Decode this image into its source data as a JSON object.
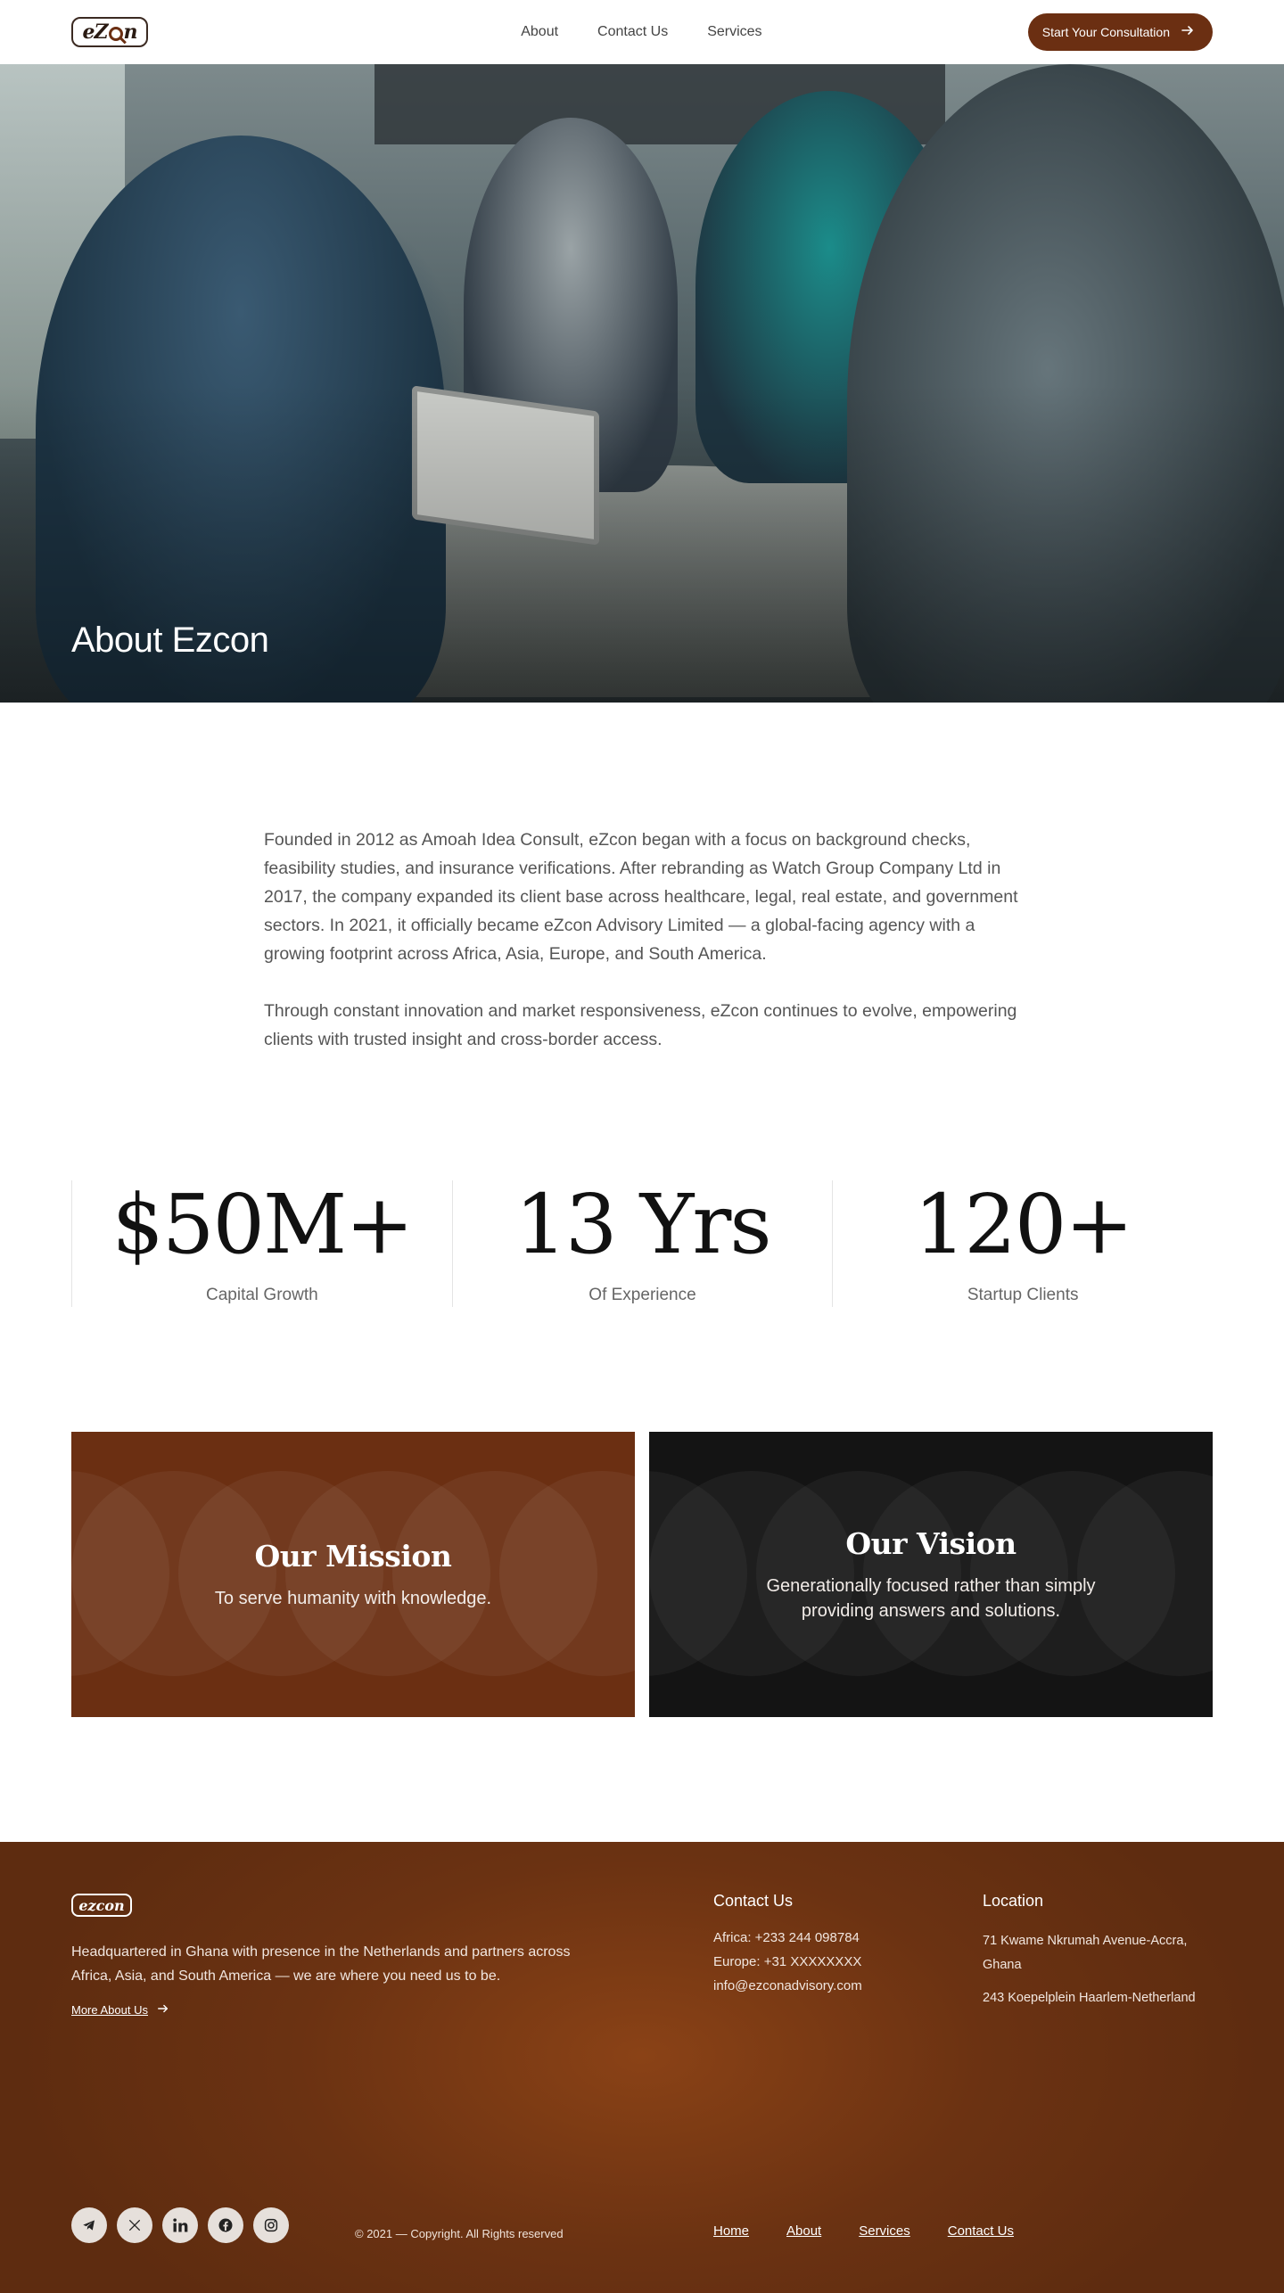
{
  "header": {
    "logo_text": "ezcon",
    "nav": [
      "About",
      "Contact Us",
      "Services"
    ],
    "cta_label": "Start Your Consultation",
    "cta_icon": "arrow-right-icon"
  },
  "hero": {
    "title": "About Ezcon"
  },
  "intro": {
    "paragraphs": [
      "Founded in 2012 as Amoah Idea Consult, eZcon began with a focus on background checks, feasibility studies, and insurance verifications. After rebranding as Watch Group Company Ltd in 2017, the company expanded its client base across healthcare, legal, real estate, and government sectors. In 2021, it officially became eZcon Advisory Limited — a global-facing agency with a growing footprint across Africa, Asia, Europe, and South America.",
      "Through constant innovation and market responsiveness, eZcon continues to evolve, empowering clients with trusted insight and cross-border access."
    ]
  },
  "stats": [
    {
      "value": "$50M+",
      "label": "Capital Growth"
    },
    {
      "value": "13 Yrs",
      "label": "Of Experience"
    },
    {
      "value": "120+",
      "label": "Startup Clients"
    }
  ],
  "mission": {
    "title": "Our Mission",
    "text": "To serve humanity with knowledge."
  },
  "vision": {
    "title": "Our Vision",
    "text": "Generationally focused rather than simply providing answers and solutions."
  },
  "footer": {
    "logo_text": "ezcon",
    "description": "Headquartered in Ghana with presence in the Netherlands and partners across Africa, Asia, and South America — we are where you need us to be.",
    "more_label": "More About Us",
    "contact_title": "Contact Us",
    "contact": [
      "Africa: +233 244 098784",
      "Europe: +31 XXXXXXXX",
      "info@ezconadvisory.com"
    ],
    "location_title": "Location",
    "locations": [
      "71 Kwame Nkrumah Avenue-Accra, Ghana",
      "243 Koepelplein Haarlem-Netherland"
    ],
    "socials": [
      "telegram-icon",
      "x-icon",
      "linkedin-icon",
      "facebook-icon",
      "instagram-icon"
    ],
    "copyright": "© 2021 — Copyright. All Rights reserved",
    "nav": [
      "Home",
      "About",
      "Services",
      "Contact Us"
    ]
  },
  "colors": {
    "brand_brown": "#6b2f12",
    "vision_bg": "#141414",
    "footer_glow": "#8a4216"
  }
}
